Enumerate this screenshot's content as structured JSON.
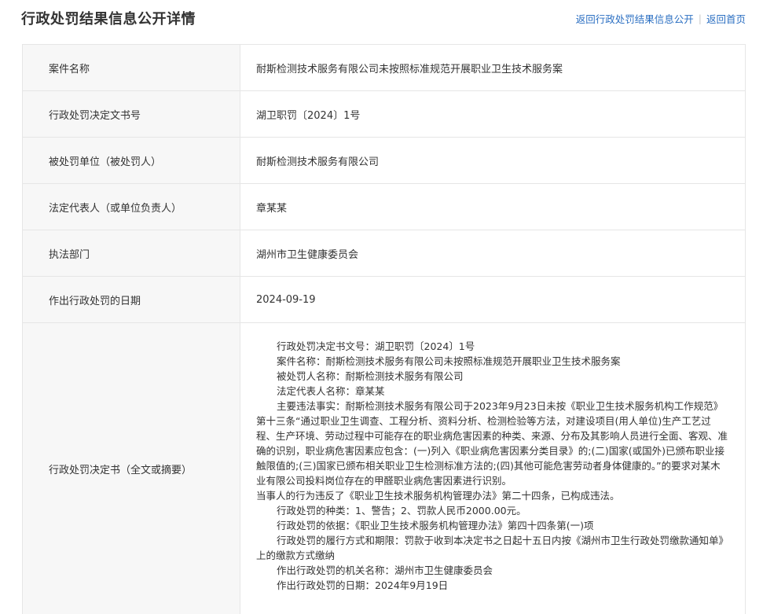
{
  "header": {
    "title": "行政处罚结果信息公开详情",
    "link_back_list": "返回行政处罚结果信息公开",
    "link_separator": "|",
    "link_home": "返回首页"
  },
  "rows": [
    {
      "label": "案件名称",
      "value": "耐斯检测技术服务有限公司未按照标准规范开展职业卫生技术服务案"
    },
    {
      "label": "行政处罚决定文书号",
      "value": "湖卫职罚〔2024〕1号"
    },
    {
      "label": "被处罚单位（被处罚人）",
      "value": "耐斯检测技术服务有限公司"
    },
    {
      "label": "法定代表人（或单位负责人）",
      "value": "章某某"
    },
    {
      "label": "执法部门",
      "value": "湖州市卫生健康委员会"
    },
    {
      "label": "作出行政处罚的日期",
      "value": "2024-09-19"
    }
  ],
  "decision": {
    "label": "行政处罚决定书（全文或摘要）",
    "paragraphs": [
      "行政处罚决定书文号：湖卫职罚〔2024〕1号",
      "案件名称：耐斯检测技术服务有限公司未按照标准规范开展职业卫生技术服务案",
      "被处罚人名称：耐斯检测技术服务有限公司",
      "法定代表人名称：章某某",
      "主要违法事实：耐斯检测技术服务有限公司于2023年9月23日未按《职业卫生技术服务机构工作规范》第十三条“通过职业卫生调查、工程分析、资料分析、检测检验等方法，对建设项目(用人单位)生产工艺过程、生产环境、劳动过程中可能存在的职业病危害因素的种类、来源、分布及其影响人员进行全面、客观、准确的识别，职业病危害因素应包含：(一)列入《职业病危害因素分类目录》的;(二)国家(或国外)已颁布职业接触限值的;(三)国家已颁布相关职业卫生检测标准方法的;(四)其他可能危害劳动者身体健康的。”的要求对某木业有限公司投料岗位存在的甲醛职业病危害因素进行识别。",
      "当事人的行为违反了《职业卫生技术服务机构管理办法》第二十四条，已构成违法。",
      "行政处罚的种类：1、警告；2、罚款人民币2000.00元。",
      "行政处罚的依据：《职业卫生技术服务机构管理办法》第四十四条第(一)项",
      "行政处罚的履行方式和期限：罚款于收到本决定书之日起十五日内按《湖州市卫生行政处罚缴款通知单》上的缴款方式缴纳",
      "作出行政处罚的机关名称：湖州市卫生健康委员会",
      "作出行政处罚的日期：2024年9月19日"
    ]
  }
}
